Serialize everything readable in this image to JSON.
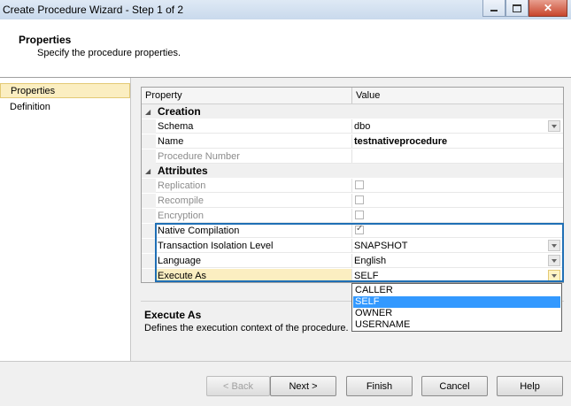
{
  "window": {
    "title": "Create Procedure Wizard - Step 1 of 2"
  },
  "header": {
    "title": "Properties",
    "subtitle": "Specify the procedure properties."
  },
  "nav": {
    "items": [
      {
        "label": "Properties",
        "selected": true
      },
      {
        "label": "Definition",
        "selected": false
      }
    ]
  },
  "grid": {
    "col_property": "Property",
    "col_value": "Value",
    "cat_creation": "Creation",
    "cat_attributes": "Attributes",
    "rows": {
      "schema": {
        "name": "Schema",
        "value": "dbo"
      },
      "name": {
        "name": "Name",
        "value": "testnativeprocedure"
      },
      "procedure_number": {
        "name": "Procedure Number",
        "value": ""
      },
      "replication": {
        "name": "Replication",
        "checked": false
      },
      "recompile": {
        "name": "Recompile",
        "checked": false
      },
      "encryption": {
        "name": "Encryption",
        "checked": false
      },
      "native_compilation": {
        "name": "Native Compilation",
        "checked": true
      },
      "isolation": {
        "name": "Transaction Isolation Level",
        "value": "SNAPSHOT"
      },
      "language": {
        "name": "Language",
        "value": "English"
      },
      "execute_as": {
        "name": "Execute As",
        "value": "SELF"
      }
    }
  },
  "dropdown": {
    "options": [
      "CALLER",
      "SELF",
      "OWNER",
      "USERNAME"
    ],
    "selected": "SELF"
  },
  "description": {
    "title": "Execute As",
    "text": "Defines the execution context of the procedure."
  },
  "buttons": {
    "back": "< Back",
    "next": "Next >",
    "finish": "Finish",
    "cancel": "Cancel",
    "help": "Help"
  },
  "colors": {
    "highlight_box": "#1f6fb5",
    "selection": "#3399ff",
    "selected_row": "#fbeec1"
  }
}
